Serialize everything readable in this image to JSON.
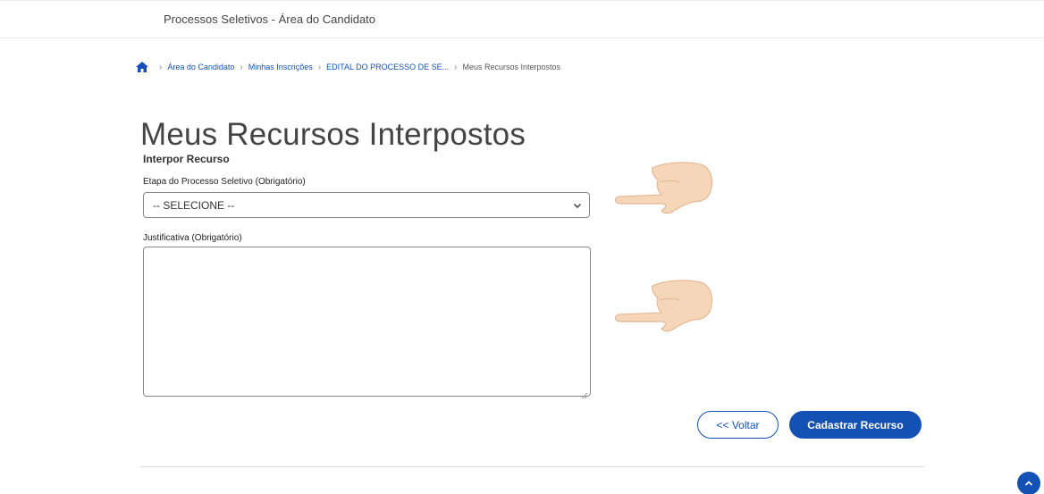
{
  "header": {
    "site_title": "Processos Seletivos - Área do Candidato"
  },
  "breadcrumb": {
    "home_icon": "home-icon",
    "items": [
      {
        "label": "Área do Candidato"
      },
      {
        "label": "Minhas Inscrições"
      },
      {
        "label": "EDITAL DO PROCESSO DE SE..."
      },
      {
        "label": "Meus Recursos Interpostos"
      }
    ]
  },
  "main": {
    "title": "Meus Recursos Interpostos",
    "section_title": "Interpor Recurso",
    "etapa": {
      "label": "Etapa do Processo Seletivo (Obrigatório)",
      "selected_value": "-- SELECIONE --"
    },
    "justificativa": {
      "label": "Justificativa (Obrigatório)",
      "value": ""
    }
  },
  "actions": {
    "voltar_label": "<< Voltar",
    "cadastrar_label": "Cadastrar Recurso"
  },
  "colors": {
    "primary": "#1351b4",
    "text": "#333333",
    "border": "#888888"
  }
}
